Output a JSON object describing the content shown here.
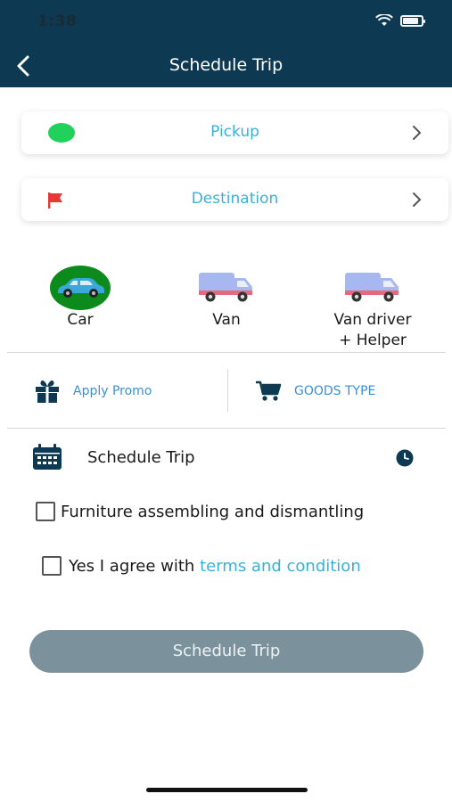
{
  "status_bar": {
    "time": "1:38",
    "battery_level": 0.85,
    "wifi_icon": "wifi-icon"
  },
  "header": {
    "title": "Schedule Trip",
    "back_icon": "chevron-left-icon",
    "bg_color": "#0d3a52"
  },
  "locations": {
    "pickup": {
      "label": "Pickup",
      "icon": "green-dot-icon",
      "chevron": "chevron-right-icon"
    },
    "destination": {
      "label": "Destination",
      "icon": "red-flag-icon",
      "chevron": "chevron-right-icon"
    }
  },
  "vehicles": [
    {
      "label": "Car",
      "icon": "car-icon",
      "selected": true
    },
    {
      "label": "Van",
      "icon": "van-icon",
      "selected": false
    },
    {
      "label_line1": "Van driver",
      "label_line2": "+ Helper",
      "icon": "van-icon",
      "selected": false
    }
  ],
  "actions": {
    "promo": {
      "label": "Apply Promo",
      "icon": "gift-icon"
    },
    "goods": {
      "label": "GOODS TYPE",
      "icon": "cart-icon"
    }
  },
  "schedule": {
    "label": "Schedule Trip",
    "calendar_icon": "calendar-icon",
    "clock_icon": "clock-icon"
  },
  "options": {
    "furniture": {
      "label": "Furniture assembling and dismantling",
      "checked": false
    },
    "terms": {
      "prefix": "Yes I agree with ",
      "link": "terms and condition",
      "checked": false
    }
  },
  "submit": {
    "label": "Schedule Trip"
  },
  "colors": {
    "accent": "#3ab0d8",
    "selected_vehicle": "#0c8a1c",
    "button": "#7b929c",
    "flag": "#e53935",
    "pickup_dot": "#22d15b"
  }
}
